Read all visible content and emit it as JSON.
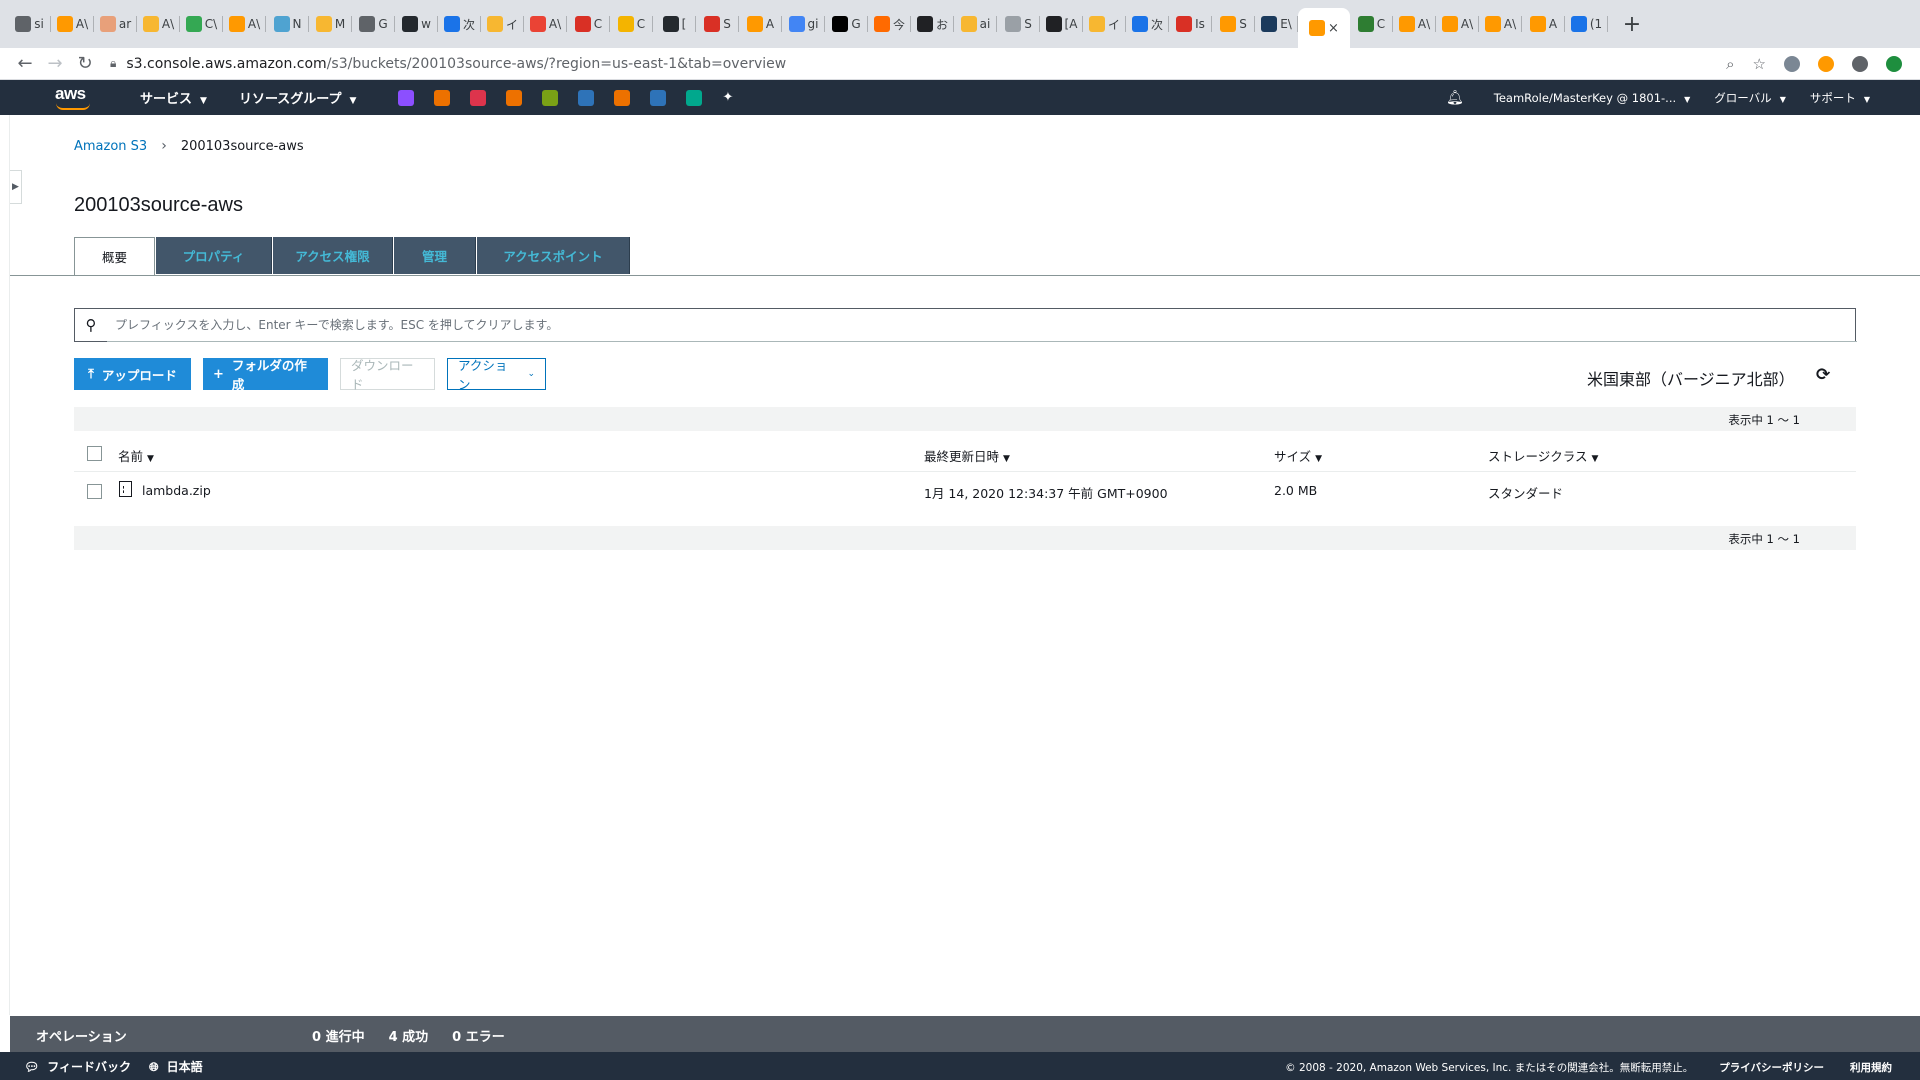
{
  "browser": {
    "tabs": [
      {
        "title": "si",
        "color": "#5f6368"
      },
      {
        "title": "A\\",
        "color": "#ff9900"
      },
      {
        "title": "ar",
        "color": "#e8a07a"
      },
      {
        "title": "A\\",
        "color": "#f7b731"
      },
      {
        "title": "C\\",
        "color": "#34a853"
      },
      {
        "title": "A\\",
        "color": "#ff9900"
      },
      {
        "title": "N",
        "color": "#4fa3d1"
      },
      {
        "title": "M",
        "color": "#f7b731"
      },
      {
        "title": "G",
        "color": "#5f6368"
      },
      {
        "title": "w",
        "color": "#24292e"
      },
      {
        "title": "次",
        "color": "#1a73e8"
      },
      {
        "title": "イ",
        "color": "#f7b731"
      },
      {
        "title": "A\\",
        "color": "#ea4335"
      },
      {
        "title": "C",
        "color": "#d93025"
      },
      {
        "title": "C",
        "color": "#f4b400"
      },
      {
        "title": "[",
        "color": "#24292e"
      },
      {
        "title": "S",
        "color": "#d93025"
      },
      {
        "title": "A",
        "color": "#ff9900"
      },
      {
        "title": "gi",
        "color": "#4285f4"
      },
      {
        "title": "G",
        "color": "#000000"
      },
      {
        "title": "今",
        "color": "#ff6a00"
      },
      {
        "title": "お",
        "color": "#202124"
      },
      {
        "title": "ai",
        "color": "#f7b731"
      },
      {
        "title": "S",
        "color": "#9aa0a6"
      },
      {
        "title": "[A",
        "color": "#202124"
      },
      {
        "title": "イ",
        "color": "#f7b731"
      },
      {
        "title": "次",
        "color": "#1a73e8"
      },
      {
        "title": "Is",
        "color": "#d93025"
      },
      {
        "title": "S",
        "color": "#ff9900"
      },
      {
        "title": "E\\",
        "color": "#1b3a5c"
      }
    ],
    "active_tab": {
      "color": "#ff9900",
      "close": "×"
    },
    "tabs_after": [
      {
        "title": "C",
        "color": "#2e7d32"
      },
      {
        "title": "A\\",
        "color": "#ff9900"
      },
      {
        "title": "A\\",
        "color": "#ff9900"
      },
      {
        "title": "A\\",
        "color": "#ff9900"
      },
      {
        "title": "A",
        "color": "#ff9900"
      },
      {
        "title": "(1",
        "color": "#1a73e8"
      }
    ],
    "new_tab": "+",
    "url_host": "s3.console.aws.amazon.com",
    "url_path": "/s3/buckets/200103source-aws/?region=us-east-1&tab=overview"
  },
  "aws_nav": {
    "logo": "aws",
    "services": "サービス",
    "resource_groups": "リソースグループ",
    "pinned_colors": [
      "#8c4fff",
      "#ed7100",
      "#dd344c",
      "#ed7100",
      "#7aa116",
      "#2e73b8",
      "#ed7100",
      "#2e73b8",
      "#01a88d"
    ],
    "account": "TeamRole/MasterKey @ 1801-...",
    "region_menu": "グローバル",
    "support": "サポート"
  },
  "breadcrumb": {
    "root": "Amazon S3",
    "current": "200103source-aws"
  },
  "page_title": "200103source-aws",
  "tabs": [
    "概要",
    "プロパティ",
    "アクセス権限",
    "管理",
    "アクセスポイント"
  ],
  "search": {
    "placeholder": "プレフィックスを入力し、Enter キーで検索します。ESC を押してクリアします。",
    "value": ""
  },
  "buttons": {
    "upload": "アップロード",
    "create_folder": "フォルダの作成",
    "download": "ダウンロード",
    "actions": "アクション"
  },
  "region_label": "米国東部（バージニア北部）",
  "pager_text": "表示中 1 〜 1",
  "table": {
    "headers": {
      "name": "名前",
      "modified": "最終更新日時",
      "size": "サイズ",
      "storage": "ストレージクラス"
    },
    "rows": [
      {
        "name": "lambda.zip",
        "modified": "1月 14, 2020 12:34:37 午前 GMT+0900",
        "size": "2.0 MB",
        "storage": "スタンダード"
      }
    ]
  },
  "operations": {
    "label": "オペレーション",
    "in_progress": "0 進行中",
    "success": "4 成功",
    "errors": "0 エラー"
  },
  "footer": {
    "feedback": "フィードバック",
    "language": "日本語",
    "copyright": "© 2008 - 2020, Amazon Web Services, Inc. またはその関連会社。無断転用禁止。",
    "privacy": "プライバシーポリシー",
    "terms": "利用規約"
  }
}
